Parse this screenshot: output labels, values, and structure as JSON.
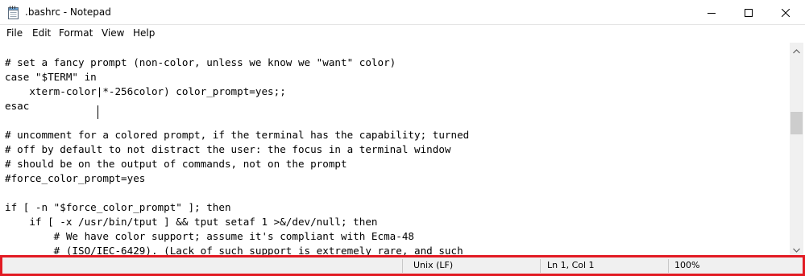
{
  "window": {
    "title": ".bashrc - Notepad",
    "app_icon": "notepad-icon",
    "controls": [
      "minimize-icon",
      "maximize-icon",
      "close-icon"
    ]
  },
  "menu": {
    "items": [
      "File",
      "Edit",
      "Format",
      "View",
      "Help"
    ]
  },
  "editor": {
    "lines": [
      "# set a fancy prompt (non-color, unless we know we \"want\" color)",
      "case \"$TERM\" in",
      "    xterm-color|*-256color) color_prompt=yes;;",
      "esac",
      "",
      "# uncomment for a colored prompt, if the terminal has the capability; turned",
      "# off by default to not distract the user: the focus in a terminal window",
      "# should be on the output of commands, not on the prompt",
      "#force_color_prompt=yes",
      "",
      "if [ -n \"$force_color_prompt\" ]; then",
      "    if [ -x /usr/bin/tput ] && tput setaf 1 >&/dev/null; then",
      "        # We have color support; assume it's compliant with Ecma-48",
      "        # (ISO/IEC-6429). (Lack of such support is extremely rare, and such"
    ]
  },
  "statusbar": {
    "line_ending": "Unix (LF)",
    "position": "Ln 1, Col 1",
    "zoom": "100%",
    "highlight_color": "#e21b23"
  }
}
